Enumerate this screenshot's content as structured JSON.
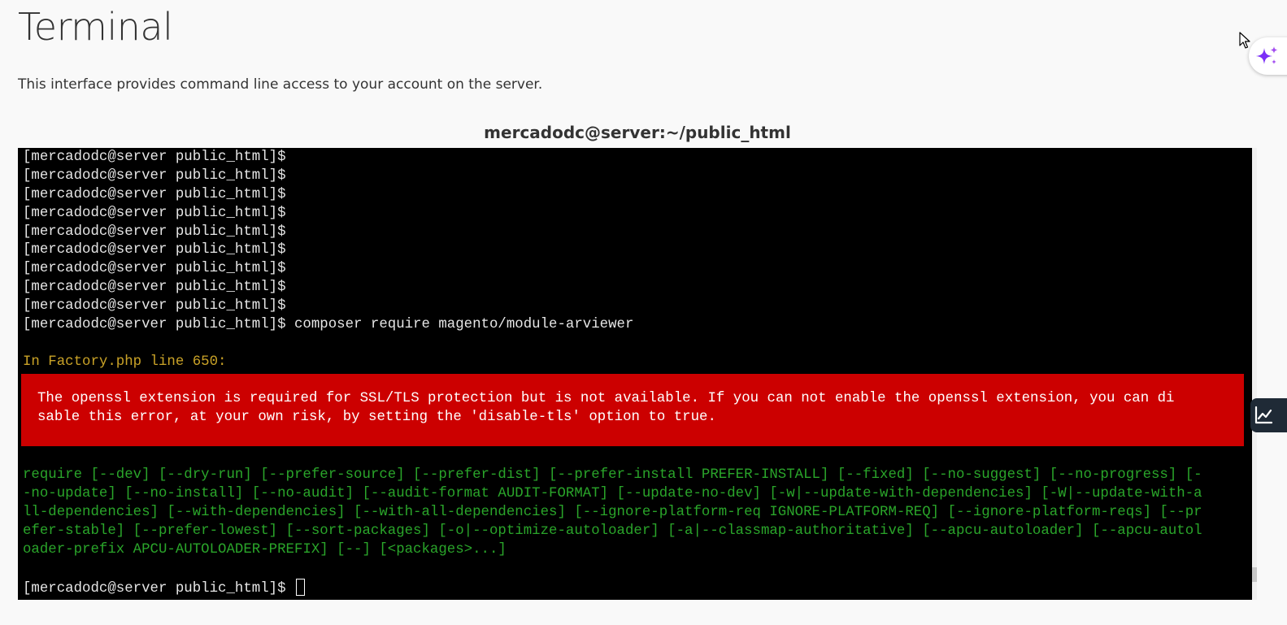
{
  "page": {
    "title": "Terminal",
    "description": "This interface provides command line access to your account on the server."
  },
  "terminal": {
    "heading": "mercadodc@server:~/public_html",
    "prompt_lines": [
      "[mercadodc@server public_html]$",
      "[mercadodc@server public_html]$",
      "[mercadodc@server public_html]$",
      "[mercadodc@server public_html]$",
      "[mercadodc@server public_html]$",
      "[mercadodc@server public_html]$",
      "[mercadodc@server public_html]$",
      "[mercadodc@server public_html]$",
      "[mercadodc@server public_html]$"
    ],
    "command_line": "[mercadodc@server public_html]$ composer require magento/module-arviewer",
    "warning_line": "In Factory.php line 650:",
    "error_lines": [
      "The openssl extension is required for SSL/TLS protection but is not available. If you can not enable the openssl extension, you can di",
      "sable this error, at your own risk, by setting the 'disable-tls' option to true."
    ],
    "usage_lines": [
      "require [--dev] [--dry-run] [--prefer-source] [--prefer-dist] [--prefer-install PREFER-INSTALL] [--fixed] [--no-suggest] [--no-progress] [-",
      "-no-update] [--no-install] [--no-audit] [--audit-format AUDIT-FORMAT] [--update-no-dev] [-w|--update-with-dependencies] [-W|--update-with-a",
      "ll-dependencies] [--with-dependencies] [--with-all-dependencies] [--ignore-platform-req IGNORE-PLATFORM-REQ] [--ignore-platform-reqs] [--pr",
      "efer-stable] [--prefer-lowest] [--sort-packages] [-o|--optimize-autoloader] [-a|--classmap-authoritative] [--apcu-autoloader] [--apcu-autol",
      "oader-prefix APCU-AUTOLOADER-PREFIX] [--] [<packages>...]"
    ],
    "final_prompt": "[mercadodc@server public_html]$ "
  },
  "colors": {
    "terminal_bg": "#000000",
    "terminal_text": "#e6e6e6",
    "warning": "#c9a227",
    "error_bg": "#cc0000",
    "usage": "#2aa52a",
    "ai_accent": "#7b2ff7"
  },
  "icons": {
    "ai_assistant": "sparkle-icon",
    "stats": "chart-line-icon",
    "mouse": "mouse-pointer-icon"
  }
}
